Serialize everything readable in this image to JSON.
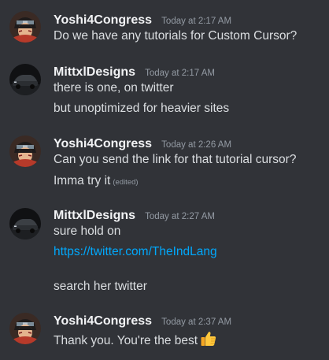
{
  "messages": [
    {
      "author": "Yoshi4Congress",
      "time": "Today at 2:17 AM",
      "lines": [
        "Do we have any tutorials for Custom Cursor?"
      ]
    },
    {
      "author": "MittxlDesigns",
      "time": "Today at 2:17 AM",
      "lines": [
        "there is one, on twitter",
        "but unoptimized for heavier sites"
      ]
    },
    {
      "author": "Yoshi4Congress",
      "time": "Today at 2:26 AM",
      "lines": [
        "Can you send the link for that tutorial cursor?",
        "Imma try it"
      ],
      "edited_label": "(edited)"
    },
    {
      "author": "MittxlDesigns",
      "time": "Today at 2:27 AM",
      "lines": [
        "sure hold on"
      ],
      "link": "https://twitter.com/TheIndLang",
      "after_link": "search her twitter"
    },
    {
      "author": "Yoshi4Congress",
      "time": "Today at 2:37 AM",
      "lines": [
        "Thank you. You're the best"
      ],
      "emoji": "thumbs-up"
    }
  ],
  "colors": {
    "background": "#313338",
    "username": "#f2f3f5",
    "text": "#dbdee1",
    "timestamp": "#949ba4",
    "link": "#00a8fc"
  }
}
